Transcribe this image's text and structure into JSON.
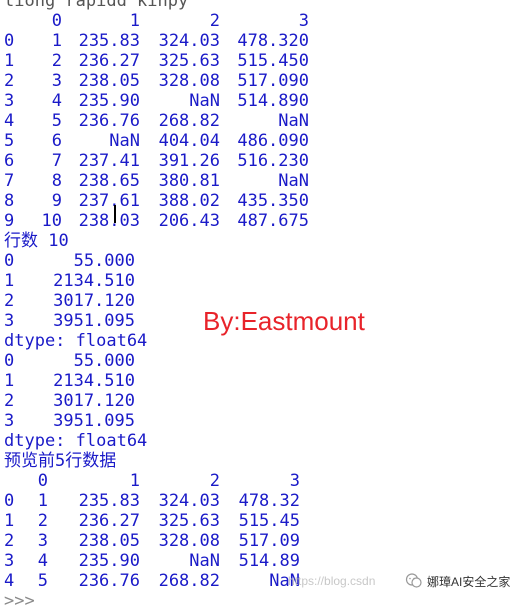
{
  "top_partial": "tiong rapidd kinpy",
  "dataframe": {
    "columns": [
      "",
      "0",
      "1",
      "2",
      "3"
    ],
    "rows": [
      [
        "0",
        "1",
        "235.83",
        "324.03",
        "478.320"
      ],
      [
        "1",
        "2",
        "236.27",
        "325.63",
        "515.450"
      ],
      [
        "2",
        "3",
        "238.05",
        "328.08",
        "517.090"
      ],
      [
        "3",
        "4",
        "235.90",
        "NaN",
        "514.890"
      ],
      [
        "4",
        "5",
        "236.76",
        "268.82",
        "NaN"
      ],
      [
        "5",
        "6",
        "NaN",
        "404.04",
        "486.090"
      ],
      [
        "6",
        "7",
        "237.41",
        "391.26",
        "516.230"
      ],
      [
        "7",
        "8",
        "238.65",
        "380.81",
        "NaN"
      ],
      [
        "8",
        "9",
        "237.61",
        "388.02",
        "435.350"
      ],
      [
        "9",
        "10",
        "238.03",
        "206.43",
        "487.675"
      ]
    ]
  },
  "row_count_line": "行数 10",
  "series1": [
    [
      "0",
      "55.000"
    ],
    [
      "1",
      "2134.510"
    ],
    [
      "2",
      "3017.120"
    ],
    [
      "3",
      "3951.095"
    ]
  ],
  "dtype1": "dtype: float64",
  "series2": [
    [
      "0",
      "55.000"
    ],
    [
      "1",
      "2134.510"
    ],
    [
      "2",
      "3017.120"
    ],
    [
      "3",
      "3951.095"
    ]
  ],
  "dtype2": "dtype: float64",
  "preview_title": "预览前5行数据",
  "head": {
    "columns": [
      "",
      "0",
      "1",
      "2",
      "3"
    ],
    "rows": [
      [
        "0",
        "1",
        "235.83",
        "324.03",
        "478.32"
      ],
      [
        "1",
        "2",
        "236.27",
        "325.63",
        "515.45"
      ],
      [
        "2",
        "3",
        "238.05",
        "328.08",
        "517.09"
      ],
      [
        "3",
        "4",
        "235.90",
        "NaN",
        "514.89"
      ],
      [
        "4",
        "5",
        "236.76",
        "268.82",
        "NaN"
      ]
    ]
  },
  "prompt": ">>>",
  "watermark": "By:Eastmount",
  "footer_url": "https://blog.csdn",
  "footer_brand": "娜璋AI安全之家",
  "colors": {
    "output_text": "#1a1ac8",
    "watermark": "#e8232a",
    "prompt": "#8a8a8a"
  }
}
